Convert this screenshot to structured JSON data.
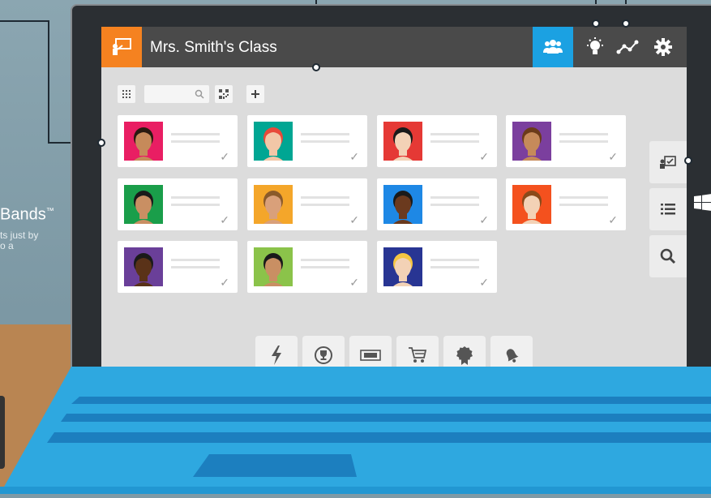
{
  "background": {
    "promo_title": "Bands",
    "promo_tm": "™",
    "promo_sub": "ts just by\no a"
  },
  "app": {
    "class_title": "Mrs. Smith's Class",
    "accent_orange": "#f58220",
    "accent_blue": "#1ba1e2",
    "topbar_icons": [
      "class-board-icon",
      "students-icon",
      "lightbulb-icon",
      "graph-icon",
      "gear-icon"
    ],
    "toolbar_icons": [
      "grid-icon",
      "search-icon",
      "qr-code-icon",
      "plus-icon"
    ],
    "students": [
      {
        "bg": "#e91e63",
        "skin": "#c68a5a",
        "hair": "#2a1a10"
      },
      {
        "bg": "#00a693",
        "skin": "#f2c7a7",
        "hair": "#e84a3a"
      },
      {
        "bg": "#e53935",
        "skin": "#f3d2b6",
        "hair": "#1a1a1a"
      },
      {
        "bg": "#7b3f9e",
        "skin": "#c68a5a",
        "hair": "#6b3b1a"
      },
      {
        "bg": "#1a9e4a",
        "skin": "#c98f63",
        "hair": "#1a1a1a"
      },
      {
        "bg": "#f4a62a",
        "skin": "#d9a07a",
        "hair": "#8a5a2a"
      },
      {
        "bg": "#1e88e5",
        "skin": "#6b3a1e",
        "hair": "#1a1a1a"
      },
      {
        "bg": "#f4511e",
        "skin": "#f3d2b6",
        "hair": "#8a4a1a"
      },
      {
        "bg": "#6a3f99",
        "skin": "#5a3218",
        "hair": "#1a1a1a"
      },
      {
        "bg": "#8bc34a",
        "skin": "#c98f63",
        "hair": "#1a1a1a"
      },
      {
        "bg": "#283593",
        "skin": "#f3d2b6",
        "hair": "#f4c542"
      }
    ],
    "side_rail_icons": [
      "attendance-icon",
      "list-icon",
      "search-icon"
    ],
    "dock_icons": [
      "lightning-icon",
      "trophy-icon",
      "ticket-icon",
      "cart-icon",
      "award-icon",
      "bell-icon"
    ]
  }
}
